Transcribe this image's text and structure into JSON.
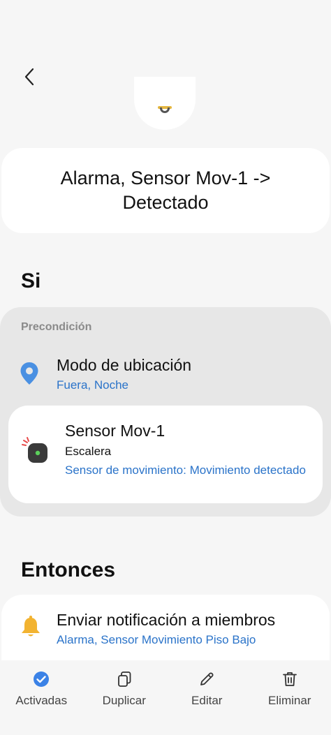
{
  "header": {
    "back_icon": "chevron-left-icon",
    "title": "Alarma, Sensor Mov-1 -> Detectado"
  },
  "si_section": {
    "label": "Si",
    "precondition_caption": "Precondición",
    "location": {
      "icon": "location-pin-icon",
      "title": "Modo de ubicación",
      "subtitle": "Fuera, Noche"
    },
    "sensor": {
      "icon": "motion-sensor-icon",
      "title": "Sensor Mov-1",
      "room": "Escalera",
      "condition": "Sensor de movimiento: Movimiento detectado"
    }
  },
  "entonces_section": {
    "label": "Entonces",
    "action": {
      "icon": "bell-icon",
      "title": "Enviar notificación a miembros",
      "subtitle": "Alarma, Sensor Movimiento Piso Bajo"
    }
  },
  "bottom_bar": {
    "items": [
      {
        "label": "Activadas",
        "icon": "check-circle-icon"
      },
      {
        "label": "Duplicar",
        "icon": "copy-icon"
      },
      {
        "label": "Editar",
        "icon": "pencil-icon"
      },
      {
        "label": "Eliminar",
        "icon": "trash-icon"
      }
    ]
  },
  "colors": {
    "accent_blue": "#2a73c9",
    "bell_yellow": "#f2b331",
    "pin_blue": "#4a90e2",
    "background": "#f6f6f6",
    "group_background": "#e7e7e7"
  }
}
